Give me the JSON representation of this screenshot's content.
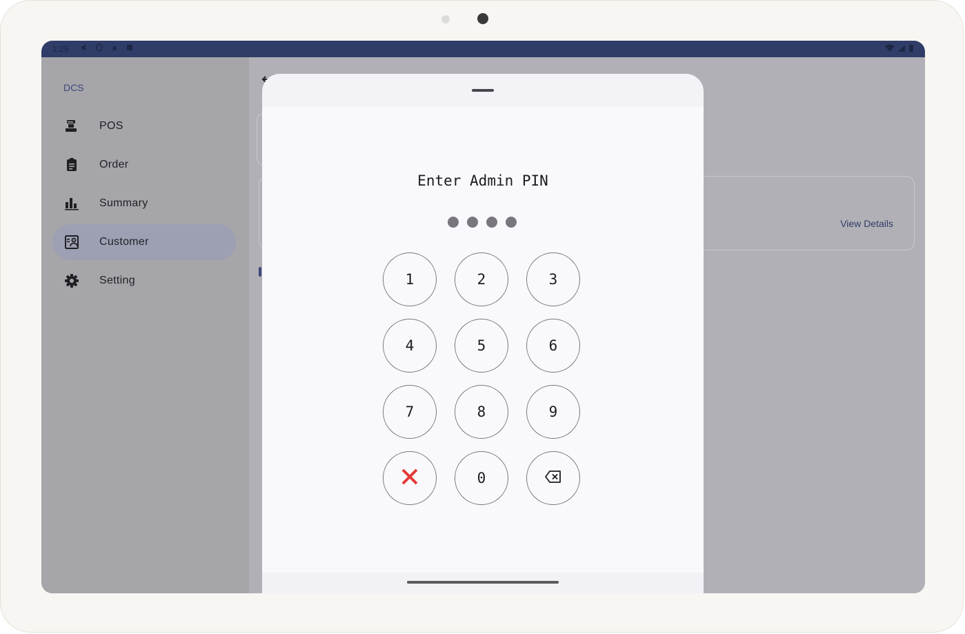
{
  "status_bar": {
    "time": "1:29",
    "left_icons": [
      "volume-icon",
      "vpn-shield-icon",
      "bug-icon",
      "media-icon"
    ],
    "right_icons": [
      "wifi-icon",
      "cell-signal-icon",
      "battery-icon"
    ]
  },
  "sidebar": {
    "brand": "DCS",
    "items": [
      {
        "label": "POS",
        "icon": "cash-register-icon",
        "active": false
      },
      {
        "label": "Order",
        "icon": "clipboard-icon",
        "active": false
      },
      {
        "label": "Summary",
        "icon": "bar-chart-icon",
        "active": false
      },
      {
        "label": "Customer",
        "icon": "contact-card-icon",
        "active": true
      },
      {
        "label": "Setting",
        "icon": "gear-icon",
        "active": false
      }
    ]
  },
  "main": {
    "back_icon": "back-arrow-icon",
    "view_details_label": "View Details"
  },
  "pin_dialog": {
    "title": "Enter Admin PIN",
    "entered_digits": 4,
    "keys": [
      "1",
      "2",
      "3",
      "4",
      "5",
      "6",
      "7",
      "8",
      "9",
      "cancel",
      "0",
      "backspace"
    ],
    "cancel_icon": "close-x-icon",
    "cancel_color": "#e53935",
    "backspace_icon": "backspace-icon"
  },
  "colors": {
    "status_bar": "#2f3d68",
    "accent": "#3d4a7a",
    "sheet_bg": "#f9f8fc"
  }
}
